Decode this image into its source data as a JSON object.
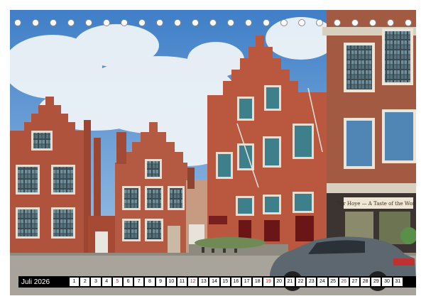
{
  "calendar": {
    "month_label": "Juli 2026",
    "sunday_color": "#d8141f",
    "days": [
      {
        "label": "1",
        "sunday": false
      },
      {
        "label": "2",
        "sunday": false
      },
      {
        "label": "3",
        "sunday": false
      },
      {
        "label": "4",
        "sunday": false
      },
      {
        "label": "5",
        "sunday": true
      },
      {
        "label": "6",
        "sunday": false
      },
      {
        "label": "7",
        "sunday": false
      },
      {
        "label": "8",
        "sunday": false
      },
      {
        "label": "9",
        "sunday": false
      },
      {
        "label": "10",
        "sunday": false
      },
      {
        "label": "11",
        "sunday": false
      },
      {
        "label": "12",
        "sunday": true
      },
      {
        "label": "13",
        "sunday": false
      },
      {
        "label": "14",
        "sunday": false
      },
      {
        "label": "15",
        "sunday": false
      },
      {
        "label": "16",
        "sunday": false
      },
      {
        "label": "17",
        "sunday": false
      },
      {
        "label": "18",
        "sunday": false
      },
      {
        "label": "19",
        "sunday": true
      },
      {
        "label": "20",
        "sunday": false
      },
      {
        "label": "21",
        "sunday": false
      },
      {
        "label": "22",
        "sunday": false
      },
      {
        "label": "23",
        "sunday": false
      },
      {
        "label": "24",
        "sunday": false
      },
      {
        "label": "25",
        "sunday": false
      },
      {
        "label": "26",
        "sunday": true
      },
      {
        "label": "27",
        "sunday": false
      },
      {
        "label": "28",
        "sunday": false
      },
      {
        "label": "29",
        "sunday": false
      },
      {
        "label": "30",
        "sunday": false
      },
      {
        "label": "31",
        "sunday": false
      }
    ]
  },
  "photo": {
    "shop_sign": "'Ter Hoye — A Taste of the World'",
    "sky_color": "#6fa3d8",
    "brick_color": "#b5543d"
  }
}
